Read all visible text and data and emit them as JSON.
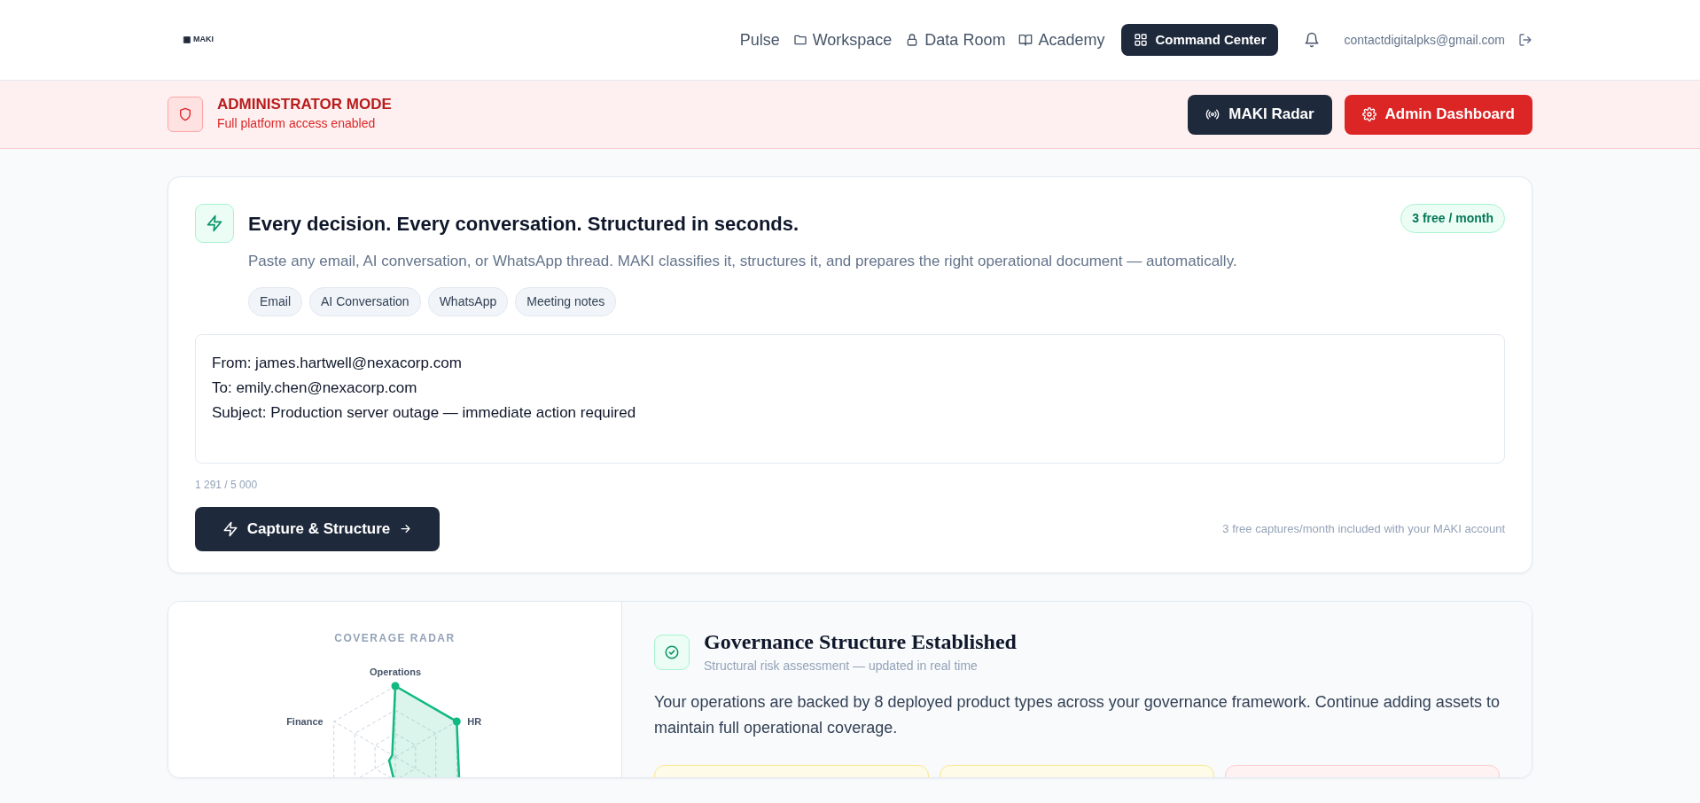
{
  "navbar": {
    "logo": "MAKI",
    "links": [
      {
        "label": "Pulse"
      },
      {
        "label": "Workspace"
      },
      {
        "label": "Data Room"
      },
      {
        "label": "Academy"
      }
    ],
    "command_button": "Command Center",
    "user_email": "contactdigitalpks@gmail.com"
  },
  "admin_banner": {
    "title": "ADMINISTRATOR MODE",
    "subtitle": "Full platform access enabled",
    "buttons": [
      {
        "label": "MAKI Radar",
        "kind": "dark"
      },
      {
        "label": "Admin Dashboard",
        "kind": "danger"
      }
    ]
  },
  "capture_card": {
    "title": "Every decision. Every conversation. Structured in seconds.",
    "badge": "3 free / month",
    "description": "Paste any email, AI conversation, or WhatsApp thread. MAKI classifies it, structures it, and prepares the right operational document — automatically.",
    "chips": [
      "Email",
      "AI Conversation",
      "WhatsApp",
      "Meeting notes"
    ],
    "input_value": "From: james.hartwell@nexacorp.com\nTo: emily.chen@nexacorp.com\nSubject: Production server outage — immediate action required",
    "counter": "1 291 / 5 000",
    "submit": "Capture & Structure",
    "note": "3 free captures/month included with your MAKI account"
  },
  "governance": {
    "radar_title": "COVERAGE RADAR",
    "radar_labels": [
      "Operations",
      "HR",
      "Finance"
    ],
    "title": "Governance Structure Established",
    "subtitle": "Structural risk assessment — updated in real time",
    "body": "Your operations are backed by 8 deployed product types across your governance framework. Continue adding assets to maintain full operational coverage.",
    "tiles": [
      {
        "color": "#fefce8"
      },
      {
        "color": "#fefce8"
      },
      {
        "color": "#fef2f2"
      }
    ]
  }
}
